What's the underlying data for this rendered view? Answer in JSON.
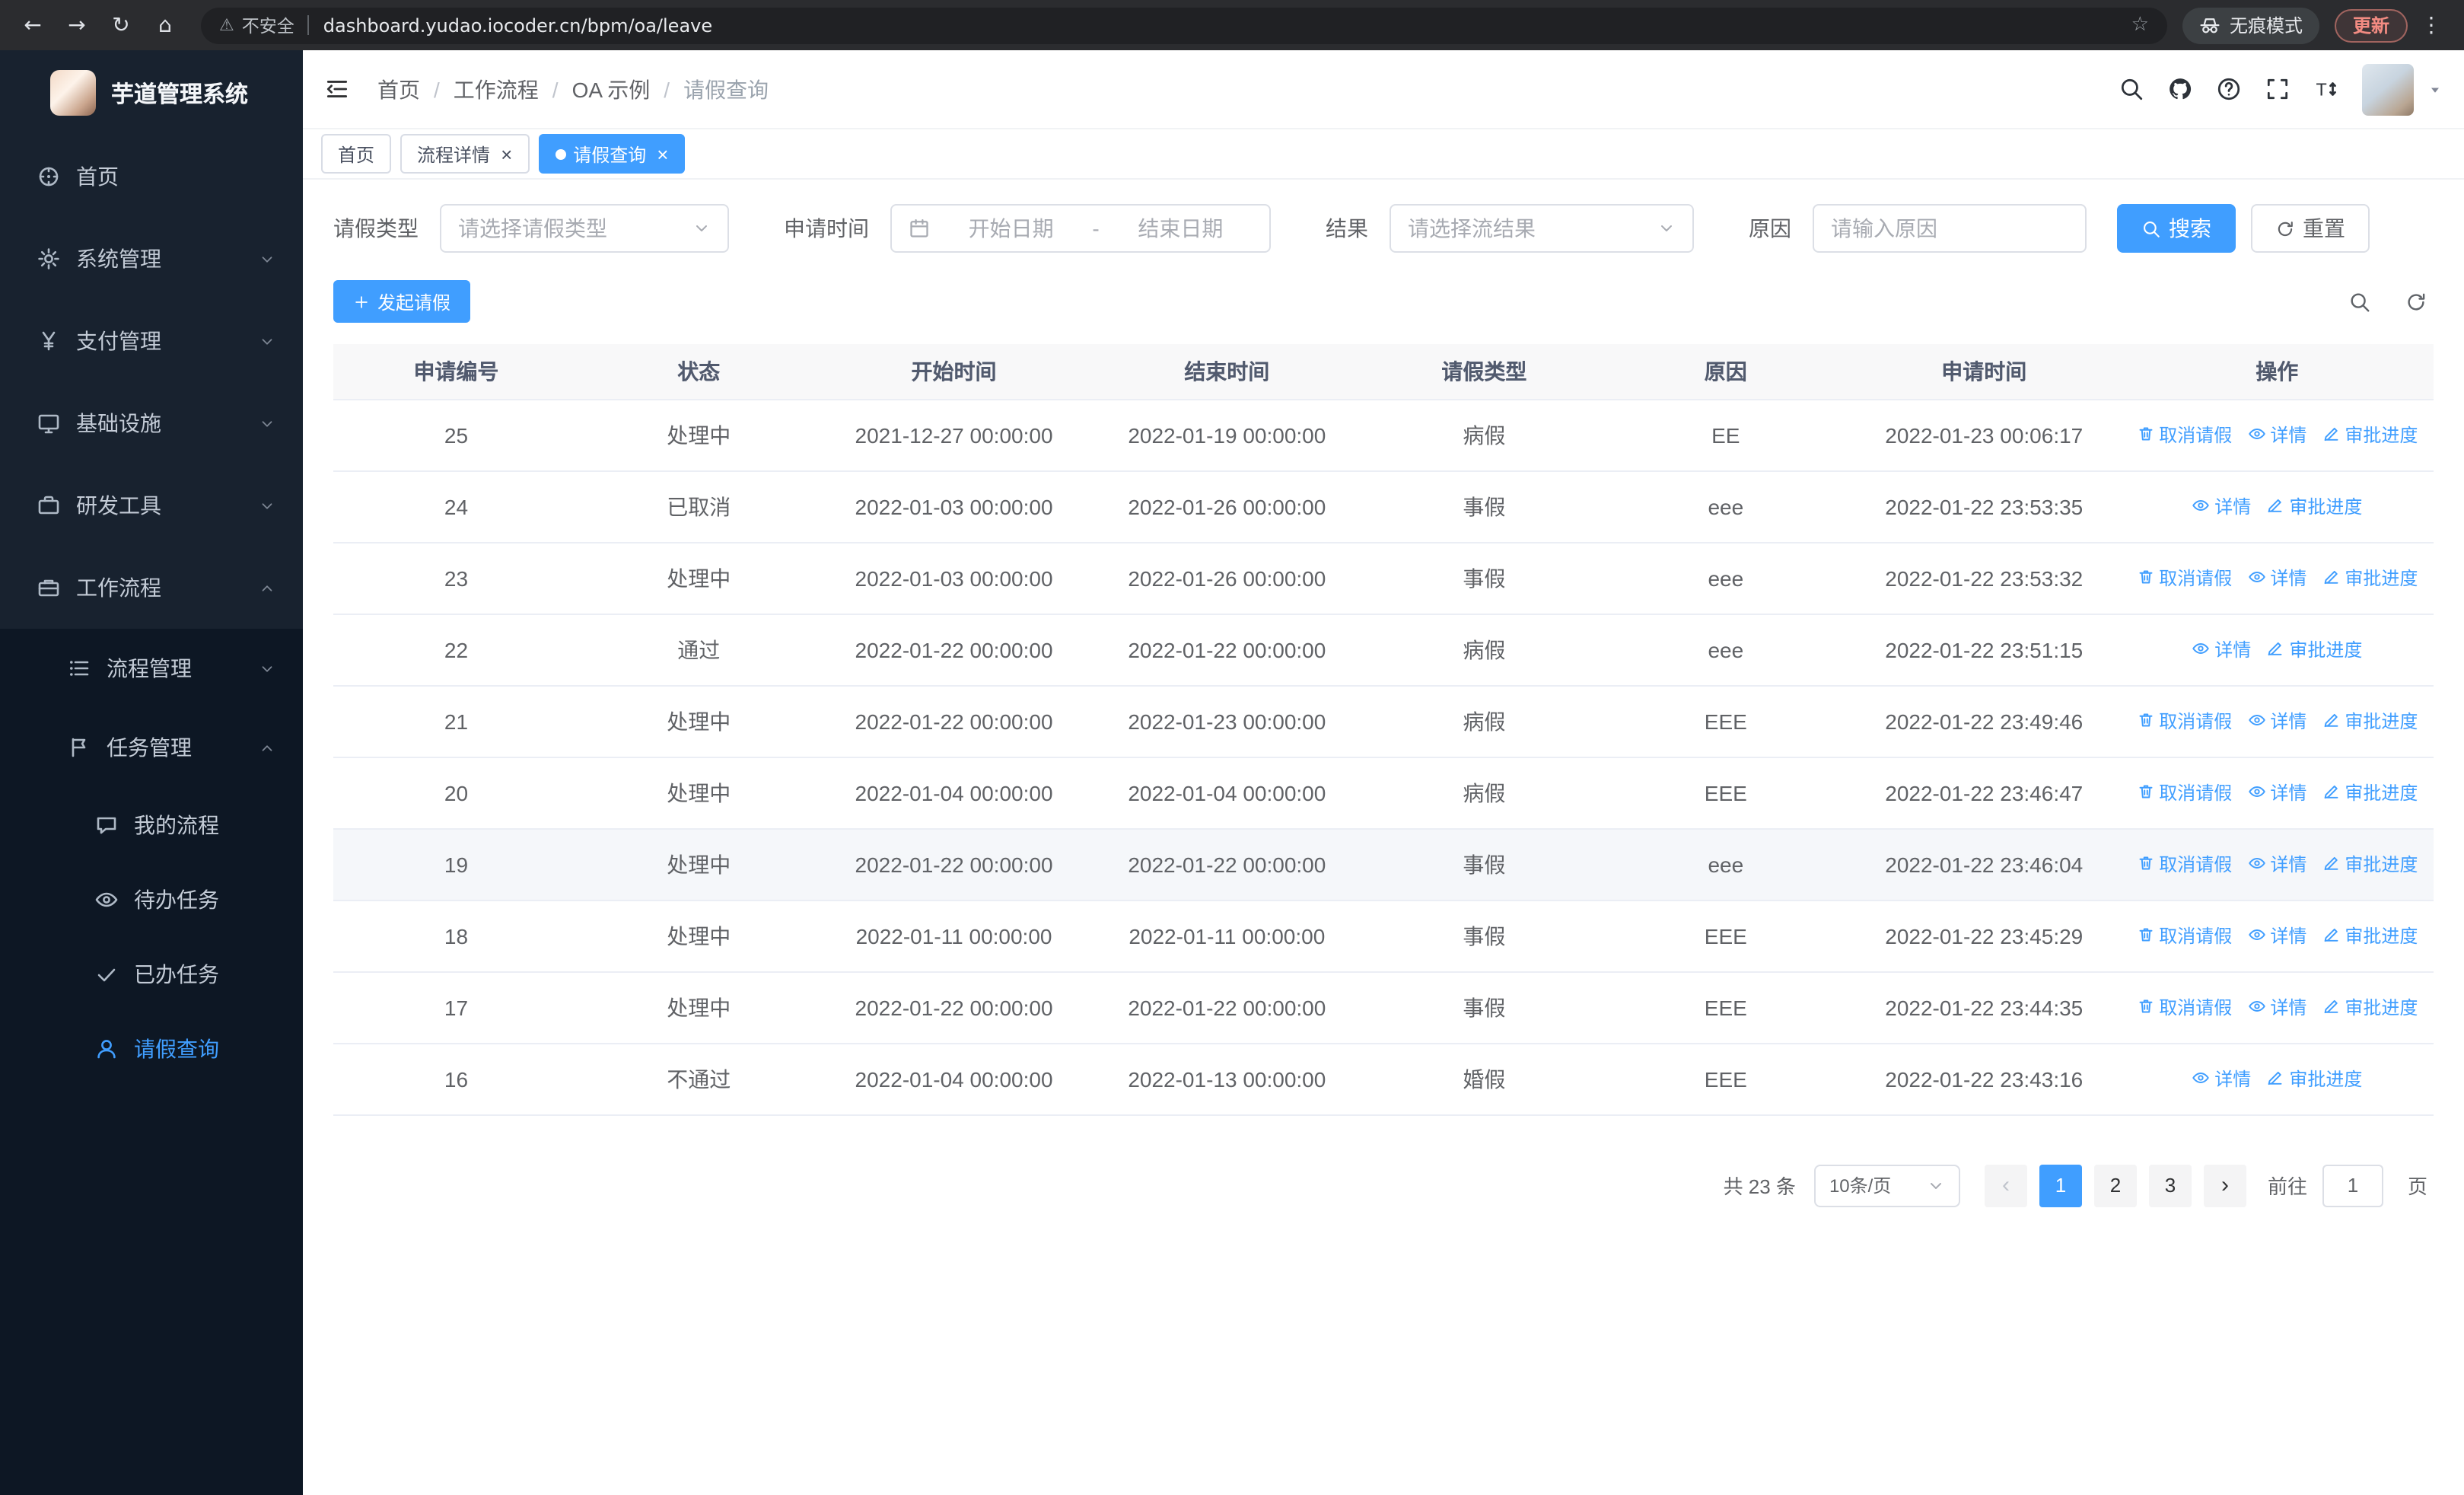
{
  "browser": {
    "security_label": "不安全",
    "url": "dashboard.yudao.iocoder.cn/bpm/oa/leave",
    "incognito_label": "无痕模式",
    "update_label": "更新"
  },
  "sidebar": {
    "logo_title": "芋道管理系统",
    "menu": [
      {
        "key": "home",
        "label": "首页",
        "icon": "dashboard-icon",
        "level": 1
      },
      {
        "key": "system",
        "label": "系统管理",
        "icon": "gear-icon",
        "level": 1,
        "chevron": "down"
      },
      {
        "key": "payment",
        "label": "支付管理",
        "icon": "yen-icon",
        "level": 1,
        "chevron": "down"
      },
      {
        "key": "infrastructure",
        "label": "基础设施",
        "icon": "monitor-icon",
        "level": 1,
        "chevron": "down"
      },
      {
        "key": "dev-tools",
        "label": "研发工具",
        "icon": "toolbox-icon",
        "level": 1,
        "chevron": "down"
      },
      {
        "key": "workflow",
        "label": "工作流程",
        "icon": "briefcase-icon",
        "level": 1,
        "chevron": "up"
      },
      {
        "key": "process-management",
        "label": "流程管理",
        "icon": "list-icon",
        "level": 2,
        "chevron": "down"
      },
      {
        "key": "task-management",
        "label": "任务管理",
        "icon": "flag-icon",
        "level": 2,
        "chevron": "up"
      },
      {
        "key": "my-process",
        "label": "我的流程",
        "icon": "chat-icon",
        "level": 3
      },
      {
        "key": "todo-tasks",
        "label": "待办任务",
        "icon": "eye-icon",
        "level": 3
      },
      {
        "key": "done-tasks",
        "label": "已办任务",
        "icon": "check-icon",
        "level": 3
      },
      {
        "key": "leave-query",
        "label": "请假查询",
        "icon": "user-icon",
        "level": 3,
        "active": true
      }
    ]
  },
  "header": {
    "breadcrumb": [
      "首页",
      "工作流程",
      "OA 示例",
      "请假查询"
    ]
  },
  "tabs": [
    {
      "key": "home",
      "label": "首页",
      "closable": false,
      "active": false
    },
    {
      "key": "process-detail",
      "label": "流程详情",
      "closable": true,
      "active": false
    },
    {
      "key": "leave-query",
      "label": "请假查询",
      "closable": true,
      "active": true
    }
  ],
  "filters": {
    "leave_type_label": "请假类型",
    "leave_type_placeholder": "请选择请假类型",
    "apply_time_label": "申请时间",
    "start_date_placeholder": "开始日期",
    "range_separator": "-",
    "end_date_placeholder": "结束日期",
    "result_label": "结果",
    "result_placeholder": "请选择流结果",
    "reason_label": "原因",
    "reason_placeholder": "请输入原因",
    "search_button": "搜索",
    "reset_button": "重置"
  },
  "toolbar": {
    "create_button": "发起请假"
  },
  "table": {
    "columns": [
      "申请编号",
      "状态",
      "开始时间",
      "结束时间",
      "请假类型",
      "原因",
      "申请时间",
      "操作"
    ],
    "column_keys": [
      "id",
      "status",
      "start-time",
      "end-time",
      "leave-type",
      "reason",
      "apply-time"
    ],
    "actions": {
      "cancel": "取消请假",
      "detail": "详情",
      "progress": "审批进度"
    },
    "rows": [
      {
        "id": "25",
        "status": "处理中",
        "start_time": "2021-12-27 00:00:00",
        "end_time": "2022-01-19 00:00:00",
        "leave_type": "病假",
        "reason": "EE",
        "apply_time": "2022-01-23 00:06:17",
        "cancellable": true,
        "highlighted": false
      },
      {
        "id": "24",
        "status": "已取消",
        "start_time": "2022-01-03 00:00:00",
        "end_time": "2022-01-26 00:00:00",
        "leave_type": "事假",
        "reason": "eee",
        "apply_time": "2022-01-22 23:53:35",
        "cancellable": false,
        "highlighted": false
      },
      {
        "id": "23",
        "status": "处理中",
        "start_time": "2022-01-03 00:00:00",
        "end_time": "2022-01-26 00:00:00",
        "leave_type": "事假",
        "reason": "eee",
        "apply_time": "2022-01-22 23:53:32",
        "cancellable": true,
        "highlighted": false
      },
      {
        "id": "22",
        "status": "通过",
        "start_time": "2022-01-22 00:00:00",
        "end_time": "2022-01-22 00:00:00",
        "leave_type": "病假",
        "reason": "eee",
        "apply_time": "2022-01-22 23:51:15",
        "cancellable": false,
        "highlighted": false
      },
      {
        "id": "21",
        "status": "处理中",
        "start_time": "2022-01-22 00:00:00",
        "end_time": "2022-01-23 00:00:00",
        "leave_type": "病假",
        "reason": "EEE",
        "apply_time": "2022-01-22 23:49:46",
        "cancellable": true,
        "highlighted": false
      },
      {
        "id": "20",
        "status": "处理中",
        "start_time": "2022-01-04 00:00:00",
        "end_time": "2022-01-04 00:00:00",
        "leave_type": "病假",
        "reason": "EEE",
        "apply_time": "2022-01-22 23:46:47",
        "cancellable": true,
        "highlighted": false
      },
      {
        "id": "19",
        "status": "处理中",
        "start_time": "2022-01-22 00:00:00",
        "end_time": "2022-01-22 00:00:00",
        "leave_type": "事假",
        "reason": "eee",
        "apply_time": "2022-01-22 23:46:04",
        "cancellable": true,
        "highlighted": true
      },
      {
        "id": "18",
        "status": "处理中",
        "start_time": "2022-01-11 00:00:00",
        "end_time": "2022-01-11 00:00:00",
        "leave_type": "事假",
        "reason": "EEE",
        "apply_time": "2022-01-22 23:45:29",
        "cancellable": true,
        "highlighted": false
      },
      {
        "id": "17",
        "status": "处理中",
        "start_time": "2022-01-22 00:00:00",
        "end_time": "2022-01-22 00:00:00",
        "leave_type": "事假",
        "reason": "EEE",
        "apply_time": "2022-01-22 23:44:35",
        "cancellable": true,
        "highlighted": false
      },
      {
        "id": "16",
        "status": "不通过",
        "start_time": "2022-01-04 00:00:00",
        "end_time": "2022-01-13 00:00:00",
        "leave_type": "婚假",
        "reason": "EEE",
        "apply_time": "2022-01-22 23:43:16",
        "cancellable": false,
        "highlighted": false
      }
    ]
  },
  "pagination": {
    "total_text": "共 23 条",
    "page_size": "10条/页",
    "prev_symbol": "‹",
    "next_symbol": "›",
    "pages": [
      "1",
      "2",
      "3"
    ],
    "active_page": "1",
    "goto_label": "前往",
    "goto_value": "1",
    "goto_suffix": "页"
  }
}
